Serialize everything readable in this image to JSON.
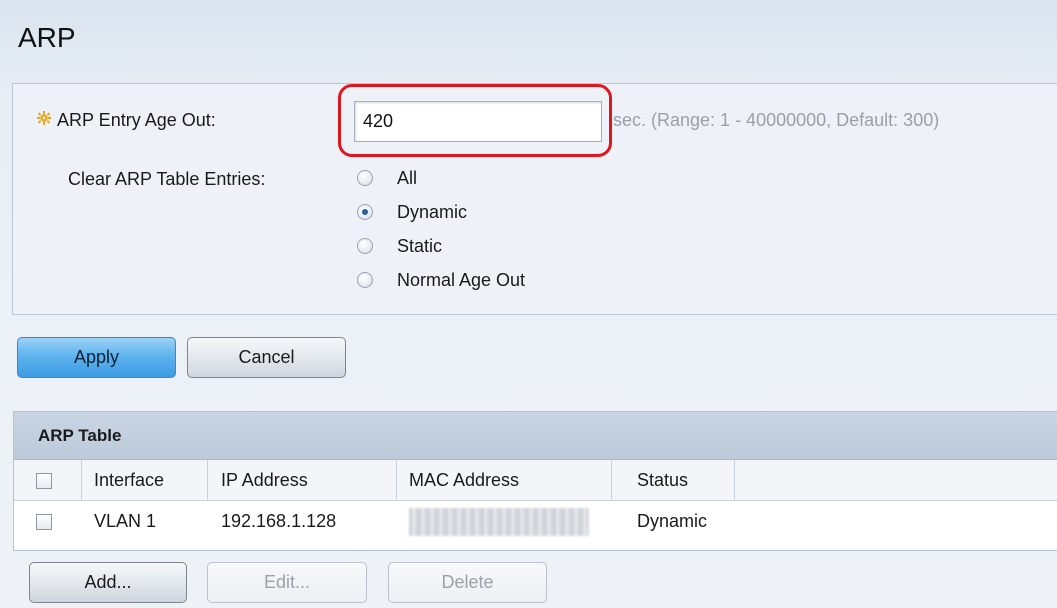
{
  "page": {
    "title": "ARP"
  },
  "settings": {
    "age_out": {
      "label": "ARP Entry Age Out:",
      "value": "420",
      "hint": "sec. (Range: 1 - 40000000, Default: 300)"
    },
    "clear_entries": {
      "label": "Clear ARP Table Entries:",
      "options": [
        {
          "label": "All",
          "checked": false
        },
        {
          "label": "Dynamic",
          "checked": true
        },
        {
          "label": "Static",
          "checked": false
        },
        {
          "label": "Normal Age Out",
          "checked": false
        }
      ],
      "selected": "Dynamic"
    }
  },
  "actions": {
    "apply_label": "Apply",
    "cancel_label": "Cancel"
  },
  "arp_table": {
    "caption": "ARP Table",
    "columns": [
      "Interface",
      "IP Address",
      "MAC Address",
      "Status"
    ],
    "rows": [
      {
        "interface": "VLAN 1",
        "ip": "192.168.1.128",
        "mac": "",
        "status": "Dynamic"
      }
    ],
    "buttons": {
      "add_label": "Add...",
      "edit_label": "Edit...",
      "delete_label": "Delete"
    }
  },
  "colors": {
    "highlight": "#e0161f",
    "apply_button": "#5fb3ee",
    "required_icon": "#e8a317"
  }
}
